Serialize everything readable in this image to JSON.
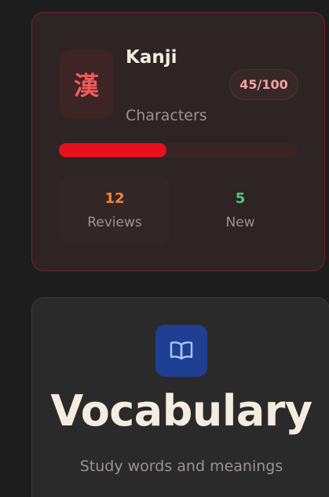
{
  "kanji_card": {
    "glyph": "漢",
    "title": "Kanji",
    "subtitle": "Characters",
    "progress_text": "45/100",
    "progress_fraction": 0.45,
    "accent_color": "#e8101e",
    "stats": {
      "reviews": {
        "count": "12",
        "label": "Reviews",
        "color": "#f2853a"
      },
      "new": {
        "count": "5",
        "label": "New",
        "color": "#4fc973"
      }
    }
  },
  "vocab_card": {
    "icon": "book-open-icon",
    "title": "Vocabulary",
    "subtitle": "Study words and meanings",
    "accent_color": "#1f3f93"
  }
}
